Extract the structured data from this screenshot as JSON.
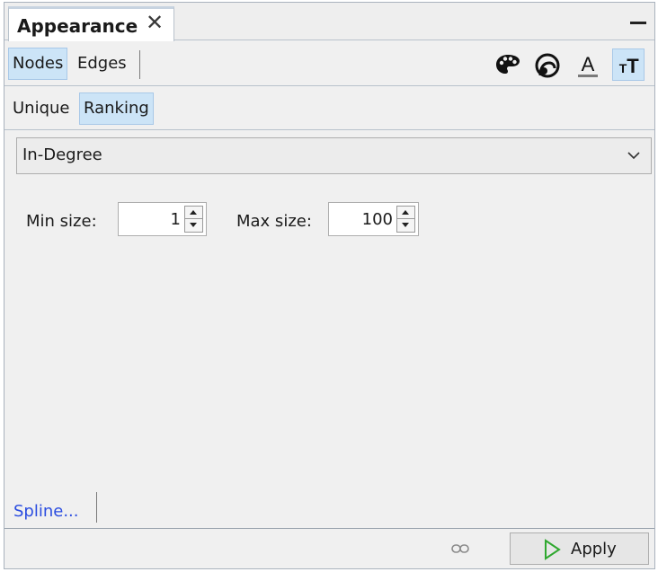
{
  "panel": {
    "title": "Appearance",
    "close_glyph": "✕",
    "minimize_icon": "minimize-icon"
  },
  "element_tabs": {
    "nodes_label": "Nodes",
    "edges_label": "Edges",
    "selected": "Nodes"
  },
  "attribute_icons": [
    {
      "name": "palette-icon",
      "meaning": "color"
    },
    {
      "name": "size-spiral-icon",
      "meaning": "size"
    },
    {
      "name": "label-color-icon",
      "meaning": "label color",
      "glyph": "A"
    },
    {
      "name": "label-size-icon",
      "meaning": "label size",
      "glyph": "TT",
      "selected": true
    }
  ],
  "mode_tabs": {
    "unique_label": "Unique",
    "ranking_label": "Ranking",
    "selected": "Ranking"
  },
  "attribute_dropdown": {
    "value": "In-Degree"
  },
  "size_range": {
    "min_label": "Min size:",
    "min_value": "1",
    "max_label": "Max size:",
    "max_value": "100"
  },
  "footer": {
    "spline_label": "Spline...",
    "apply_label": "Apply"
  },
  "colors": {
    "selected_bg": "#cce4f7",
    "link_blue": "#2b4de0",
    "apply_green": "#2fa82f"
  }
}
